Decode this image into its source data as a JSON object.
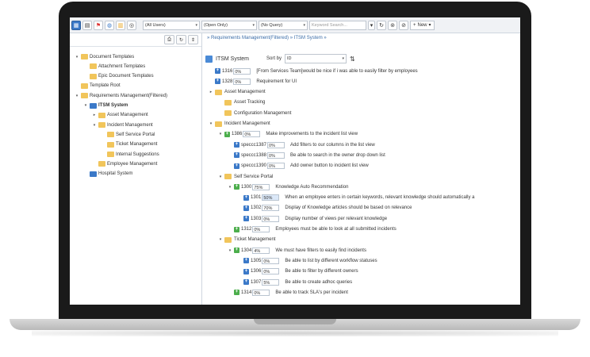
{
  "toolbar": {
    "filter_users": "(All Users)",
    "filter_open": "(Open Only)",
    "filter_query": "(No Query)",
    "search_placeholder": "Keyword Search...",
    "new_label": "New"
  },
  "breadcrumb": {
    "text": "» Requirements Management(Filtered) » ITSM System »"
  },
  "right_header": {
    "title": "ITSM System",
    "sort_by_label": "Sort by",
    "sort_value": "ID"
  },
  "tree": [
    {
      "label": "Document Templates",
      "depth": 0,
      "twisty": "▾"
    },
    {
      "label": "Attachment Templates",
      "depth": 1,
      "twisty": ""
    },
    {
      "label": "Epic Document Templates",
      "depth": 1,
      "twisty": ""
    },
    {
      "label": "Template Root",
      "depth": 0,
      "twisty": ""
    },
    {
      "label": "Requirements Management(Filtered)",
      "depth": 0,
      "twisty": "▾"
    },
    {
      "label": "ITSM System",
      "depth": 1,
      "twisty": "▾"
    },
    {
      "label": "Asset Management",
      "depth": 2,
      "twisty": "▸"
    },
    {
      "label": "Incident Management",
      "depth": 2,
      "twisty": "▾"
    },
    {
      "label": "Self Service Portal",
      "depth": 3,
      "twisty": ""
    },
    {
      "label": "Ticket Management",
      "depth": 3,
      "twisty": ""
    },
    {
      "label": "Internal Suggestions",
      "depth": 3,
      "twisty": ""
    },
    {
      "label": "Employee Management",
      "depth": 2,
      "twisty": ""
    },
    {
      "label": "Hospital System",
      "depth": 1,
      "twisty": ""
    }
  ],
  "rows": [
    {
      "kind": "item",
      "depth": 0,
      "id": "1316",
      "pct": "0%",
      "text": "[From Services Team]would be nice if i was able to easily filter by employees"
    },
    {
      "kind": "item",
      "depth": 0,
      "id": "1328",
      "pct": "0%",
      "text": "Requirement for UI"
    },
    {
      "kind": "folder",
      "depth": 0,
      "twisty": "▸",
      "text": "Asset Management"
    },
    {
      "kind": "folder",
      "depth": 1,
      "twisty": "",
      "text": "Asset Tracking"
    },
    {
      "kind": "folder",
      "depth": 1,
      "twisty": "",
      "text": "Configuration Management"
    },
    {
      "kind": "folder",
      "depth": 0,
      "twisty": "▾",
      "text": "Incident Management"
    },
    {
      "kind": "item",
      "depth": 1,
      "twisty": "▾",
      "green": true,
      "id": "1386",
      "pct": "0%",
      "text": "Make improvements to the incident list view"
    },
    {
      "kind": "item",
      "depth": 2,
      "id": "speccc1387",
      "pct": "0%",
      "text": "Add filters to our columns in the list view"
    },
    {
      "kind": "item",
      "depth": 2,
      "id": "speccc1388",
      "pct": "0%",
      "text": "Be able to search in the owner drop down list"
    },
    {
      "kind": "item",
      "depth": 2,
      "id": "speccc1390",
      "pct": "0%",
      "text": "Add owner button to incident list view"
    },
    {
      "kind": "folder",
      "depth": 1,
      "twisty": "▾",
      "text": "Self Service Portal"
    },
    {
      "kind": "item",
      "depth": 2,
      "twisty": "▾",
      "green": true,
      "id": "1300",
      "pct": "75%",
      "text": "Knowledge Auto Recommendation"
    },
    {
      "kind": "item",
      "depth": 3,
      "id": "1301",
      "pct": "50%",
      "hl": true,
      "text": "When an employee enters in certain keywords, relevant knowledge should automatically a"
    },
    {
      "kind": "item",
      "depth": 3,
      "id": "1302",
      "pct": "70%",
      "text": "Display of Knowledge articles should be based on relevance"
    },
    {
      "kind": "item",
      "depth": 3,
      "id": "1303",
      "pct": "0%",
      "text": "Display number of views per relevant knowledge"
    },
    {
      "kind": "item",
      "depth": 2,
      "green": true,
      "id": "1312",
      "pct": "0%",
      "text": "Employees must be able to look at all submitted incidents"
    },
    {
      "kind": "folder",
      "depth": 1,
      "twisty": "▾",
      "text": "Ticket Management"
    },
    {
      "kind": "item",
      "depth": 2,
      "twisty": "▾",
      "green": true,
      "id": "1304",
      "pct": "4%",
      "text": "We must have filters to easily find incidents"
    },
    {
      "kind": "item",
      "depth": 3,
      "id": "1305",
      "pct": "0%",
      "text": "Be able to list by different workflow statuses"
    },
    {
      "kind": "item",
      "depth": 3,
      "id": "1306",
      "pct": "0%",
      "text": "Be able to filter by different owners"
    },
    {
      "kind": "item",
      "depth": 3,
      "id": "1307",
      "pct": "5%",
      "text": "Be able to create adhoc queries"
    },
    {
      "kind": "item",
      "depth": 2,
      "green": true,
      "id": "1314",
      "pct": "0%",
      "text": "Be able to track SLA's per incident"
    }
  ],
  "colors": {
    "accent": "#3b79c8",
    "green": "#4cae4c",
    "folder": "#f1c55b"
  }
}
